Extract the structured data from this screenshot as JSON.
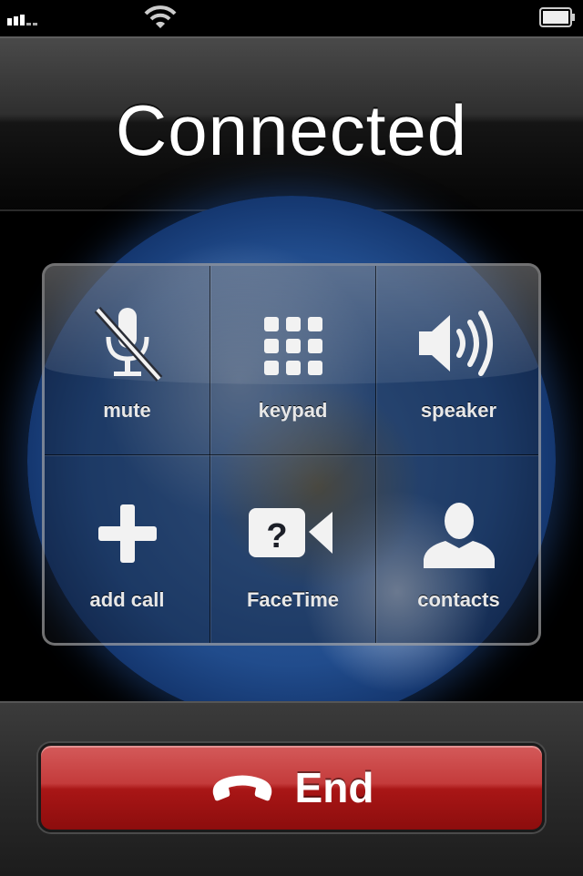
{
  "status_bar": {
    "signal_icon": "signal-bars-icon",
    "wifi_icon": "wifi-icon",
    "battery_icon": "battery-icon"
  },
  "header": {
    "title": "Connected"
  },
  "controls": [
    {
      "label": "mute",
      "icon": "mute-microphone-icon"
    },
    {
      "label": "keypad",
      "icon": "keypad-icon"
    },
    {
      "label": "speaker",
      "icon": "speaker-icon"
    },
    {
      "label": "add call",
      "icon": "plus-icon"
    },
    {
      "label": "FaceTime",
      "icon": "facetime-unavailable-icon"
    },
    {
      "label": "contacts",
      "icon": "contact-person-icon"
    }
  ],
  "end_button": {
    "label": "End",
    "icon": "hang-up-phone-icon",
    "color": "#b01e1e"
  }
}
